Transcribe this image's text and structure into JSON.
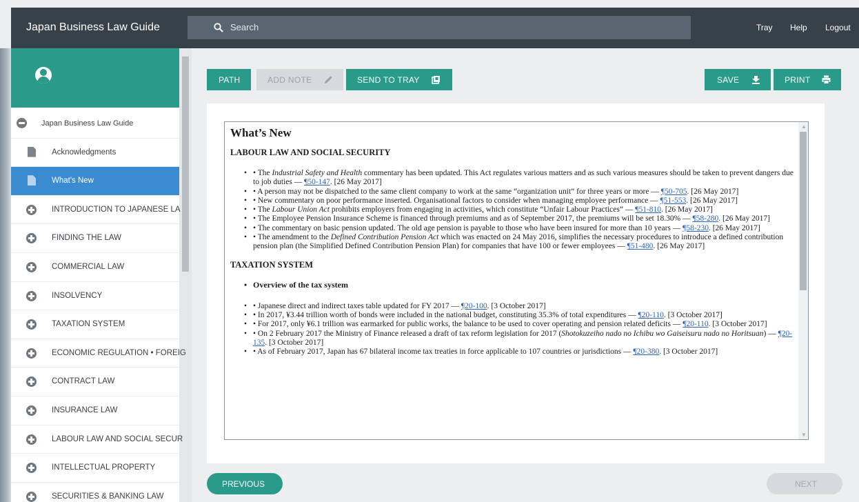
{
  "header": {
    "app_title": "Japan Business Law Guide",
    "search_placeholder": "Search",
    "links": {
      "tray": "Tray",
      "help": "Help",
      "logout": "Logout"
    }
  },
  "sidebar": {
    "root_label": "Japan Business Law Guide",
    "items": [
      {
        "label": "Acknowledgments",
        "icon": "document-icon",
        "active": false
      },
      {
        "label": "What's New",
        "icon": "document-icon",
        "active": true
      },
      {
        "label": "INTRODUCTION TO JAPANESE LA",
        "icon": "plus-icon",
        "active": false
      },
      {
        "label": "FINDING THE LAW",
        "icon": "plus-icon",
        "active": false
      },
      {
        "label": "COMMERCIAL LAW",
        "icon": "plus-icon",
        "active": false
      },
      {
        "label": "INSOLVENCY",
        "icon": "plus-icon",
        "active": false
      },
      {
        "label": "TAXATION SYSTEM",
        "icon": "plus-icon",
        "active": false
      },
      {
        "label": "ECONOMIC REGULATION • FOREIG",
        "icon": "plus-icon",
        "active": false
      },
      {
        "label": "CONTRACT LAW",
        "icon": "plus-icon",
        "active": false
      },
      {
        "label": "INSURANCE LAW",
        "icon": "plus-icon",
        "active": false
      },
      {
        "label": "LABOUR LAW AND SOCIAL SECUR",
        "icon": "plus-icon",
        "active": false
      },
      {
        "label": "INTELLECTUAL PROPERTY",
        "icon": "plus-icon",
        "active": false
      },
      {
        "label": "SECURITIES & BANKING LAW",
        "icon": "plus-icon",
        "active": false
      }
    ]
  },
  "toolbar": {
    "path": "PATH",
    "add_note": "ADD NOTE",
    "send_to_tray": "SEND TO TRAY",
    "save": "SAVE",
    "print": "PRINT"
  },
  "document": {
    "title": "What’s New",
    "sections": [
      {
        "heading": "LABOUR LAW AND SOCIAL SECURITY",
        "bullets": [
          {
            "pre": "• The ",
            "em": "Industrial Safety and Health",
            "mid": " commentary has been updated. This Act regulates various matters and as such various measures should be taken to prevent dangers due to job duties — ",
            "link": "¶50-147",
            "post": ". [26 May 2017]"
          },
          {
            "pre": "• A person may not be dispatched to the same client company to work at the same “organization unit” for three years or more — ",
            "em": "",
            "mid": "",
            "link": "¶50-705",
            "post": ". [26 May 2017]"
          },
          {
            "pre": "• New commentary on poor performance inserted. Organisational factors to consider when managing employee performance — ",
            "em": "",
            "mid": "",
            "link": "¶51-553",
            "post": ". [26 May 2017]"
          },
          {
            "pre": "• The ",
            "em": "Labour Union Act",
            "mid": " prohibits employers from engaging in activities, which constitute “Unfair Labour Practices” — ",
            "link": "¶51-810",
            "post": ". [26 May 2017]"
          },
          {
            "pre": "• The Employee Pension Insurance Scheme is financed through premiums and as of September 2017, the premiums will be set 18.30% — ",
            "em": "",
            "mid": "",
            "link": "¶58-280",
            "post": ". [26 May 2017]"
          },
          {
            "pre": "• The commentary on basic pension updated. The old age pension is payable to those who have been insured for more than 10 years — ",
            "em": "",
            "mid": "",
            "link": "¶58-230",
            "post": ". [26 May 2017]"
          },
          {
            "pre": "• The amendment to the ",
            "em": "Defined Contribution Pension Act",
            "mid": " which was enacted on 24 May 2016, simplifies the necessary procedures to introduce a defined contribution pension plan (the Simplified Defined Contribution Pension Plan) for companies that have 100 or fewer employees — ",
            "link": "¶51-480",
            "post": ". [26 May 2017]"
          }
        ]
      },
      {
        "heading": "TAXATION SYSTEM",
        "subheading": "Overview of the tax system",
        "bullets": [
          {
            "pre": "• Japanese direct and indirect taxes table updated for FY 2017 — ",
            "em": "",
            "mid": "",
            "link": "¶20-100",
            "post": ". [3 October 2017]"
          },
          {
            "pre": "• In 2017, ¥3.44 trillion worth of bonds were included in the national budget, constituting 35.3% of total expenditures — ",
            "em": "",
            "mid": "",
            "link": "¶20-110",
            "post": ". [3 October 2017]"
          },
          {
            "pre": "• For 2017, only ¥6.1 trillion was earmarked for public works, the balance to be used to cover operating and pension related deficits — ",
            "em": "",
            "mid": "",
            "link": "¶20-110",
            "post": ". [3 October 2017]"
          },
          {
            "pre": "• On 2 February 2017 the Ministry of Finance released a draft of tax reform legislation for 2017 (",
            "em": "Shotokuzeiho nado no Ichibu wo Gaiseisuru nado no Horitsuan",
            "mid": ") — ",
            "link": "¶20-135",
            "post": ". [3 October 2017]"
          },
          {
            "pre": "• As of February 2017, Japan has 67 bilateral income tax treaties in force applicable to 107 countries or jurisdictions — ",
            "em": "",
            "mid": "",
            "link": "¶20-380",
            "post": ". [3 October 2017]"
          }
        ]
      }
    ]
  },
  "footer": {
    "previous": "PREVIOUS",
    "next": "NEXT"
  },
  "colors": {
    "topbar": "#37414a",
    "teal": "#2a9a8a",
    "active_blue": "#3a8bd0",
    "link": "#2c63b5"
  }
}
